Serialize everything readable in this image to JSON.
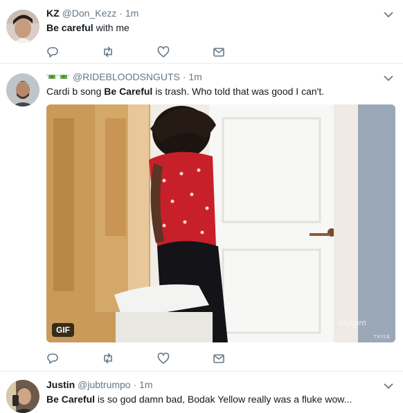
{
  "tweets": [
    {
      "name": "KZ",
      "handle": "@Don_Kezz",
      "separator": "·",
      "time": "1m",
      "text_bold": "Be careful",
      "text_rest": " with me"
    },
    {
      "name": "",
      "handle": "@RIDEBLOODSNGUTS",
      "separator": "·",
      "time": "1m",
      "text_before": "Cardi b song ",
      "text_bold": "Be Careful",
      "text_after": " is trash. Who told that was good I can't.",
      "gif_badge": "GIF",
      "watermark": "oxygen",
      "watermark_small": "T.KYLE"
    },
    {
      "name": "Justin",
      "handle": "@jubtrumpo",
      "separator": "·",
      "time": "1m",
      "text_bold": "Be Careful",
      "text_rest": " is so god damn bad, Bodak Yellow really was a fluke wow..."
    }
  ],
  "icons": {
    "reply": "reply-icon",
    "retweet": "retweet-icon",
    "like": "heart-icon",
    "dm": "envelope-icon",
    "caret": "chevron-down-icon"
  },
  "colors": {
    "icon_gray": "#657786",
    "divider": "#e6ecf0",
    "text": "#14171a"
  }
}
